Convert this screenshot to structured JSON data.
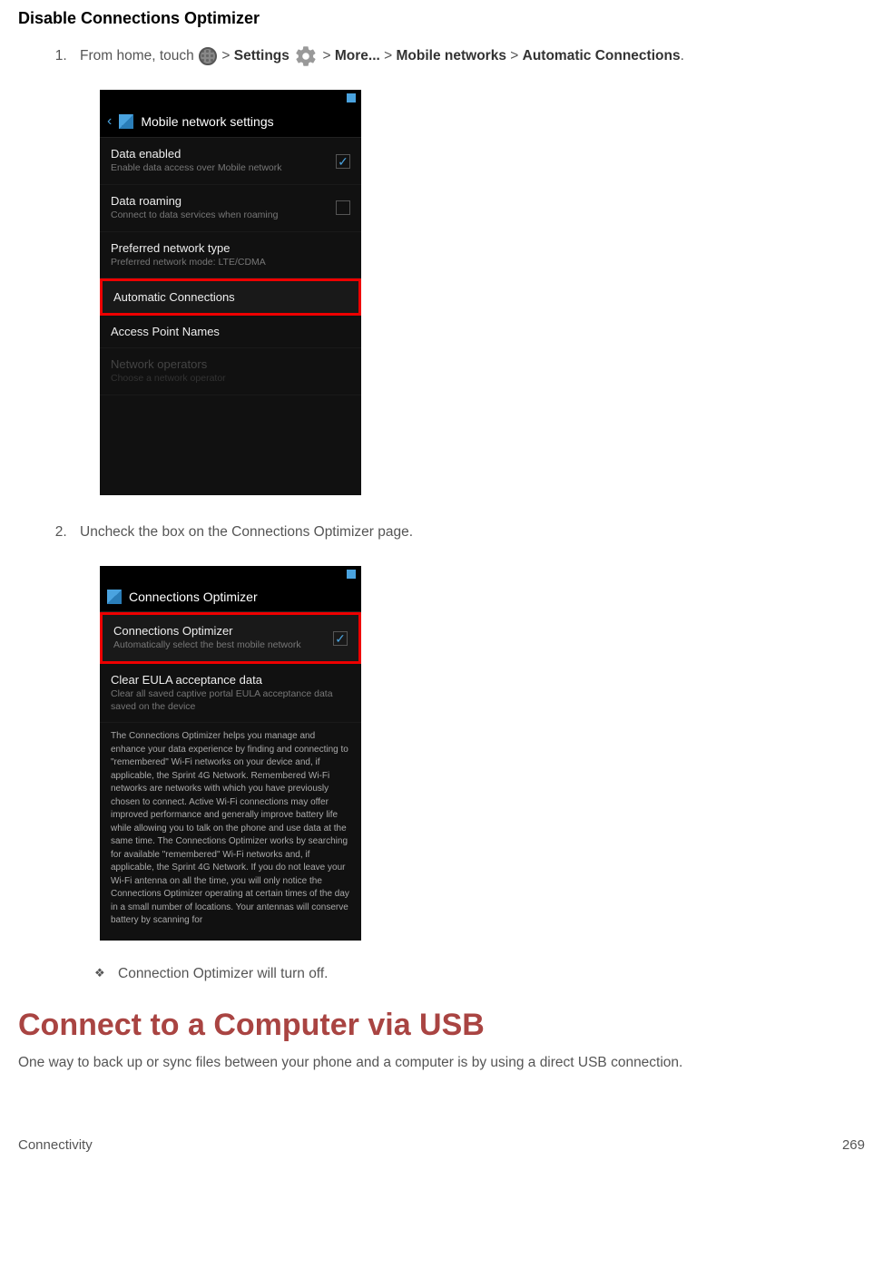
{
  "heading_disable": "Disable Connections Optimizer",
  "step1": {
    "prefix": "From home, touch ",
    "sep": " > ",
    "settings_label": "Settings",
    "more_label": "More...",
    "mobile_networks_label": "Mobile networks",
    "automatic_label": "Automatic Connections",
    "period": "."
  },
  "screenshot1": {
    "header_title": "Mobile network settings",
    "rows": [
      {
        "title": "Data enabled",
        "sub": "Enable data access over Mobile network",
        "check": true
      },
      {
        "title": "Data roaming",
        "sub": "Connect to data services when roaming",
        "check_empty": true
      },
      {
        "title": "Preferred network type",
        "sub": "Preferred network mode: LTE/CDMA"
      },
      {
        "title": "Automatic Connections",
        "sub": "",
        "highlighted": true
      },
      {
        "title": "Access Point Names",
        "sub": ""
      },
      {
        "title": "Network operators",
        "sub": "Choose a network operator",
        "disabled": true
      }
    ]
  },
  "step2_text": "Uncheck the box on the Connections Optimizer page.",
  "screenshot2": {
    "header_title": "Connections Optimizer",
    "row_optimizer": {
      "title": "Connections Optimizer",
      "sub": "Automatically select the best mobile network"
    },
    "row_clear": {
      "title": "Clear EULA acceptance data",
      "sub": "Clear all saved captive portal EULA acceptance data saved on the device"
    },
    "info_text": "The Connections Optimizer helps you manage and enhance your data experience by finding and connecting to \"remembered\" Wi-Fi networks on your device and, if applicable, the Sprint 4G Network. Remembered Wi-Fi networks are networks with which you have previously chosen to connect. Active Wi-Fi connections may offer improved performance and generally improve battery life while allowing you to talk on the phone and use data at the same time. The Connections Optimizer works by searching for available \"remembered\" Wi-Fi networks and, if applicable, the Sprint 4G Network. If you do not leave your Wi-Fi antenna on all the time, you will only notice the Connections Optimizer operating at certain times of the day in a small number of locations. Your antennas will conserve battery by scanning for"
  },
  "bullet_off": "Connection Optimizer will turn off.",
  "heading_usb": "Connect to a Computer via USB",
  "usb_paragraph": "One way to back up or sync files between your phone and a computer is by using a direct USB connection.",
  "footer_left": "Connectivity",
  "footer_right": "269"
}
